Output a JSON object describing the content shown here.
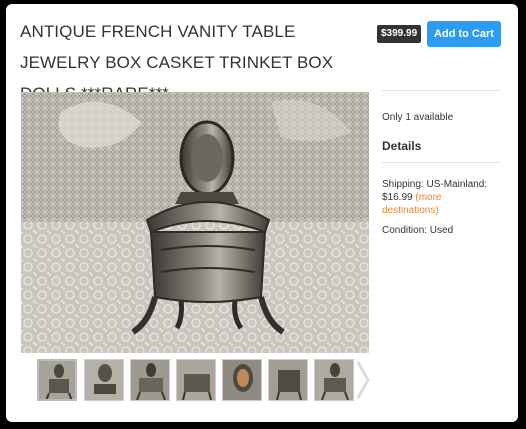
{
  "listing": {
    "title": "ANTIQUE FRENCH VANITY TABLE JEWELRY BOX CASKET TRINKET BOX DOLLS ***RARE***",
    "price": "$399.99",
    "add_to_cart": "Add to Cart"
  },
  "sidebar": {
    "availability": "Only 1 available",
    "details_heading": "Details",
    "shipping_prefix": "Shipping: US-Mainland:",
    "shipping_price": "$16.99",
    "more_destinations": "(more destinations)",
    "condition": "Condition: Used"
  },
  "gallery": {
    "thumbnail_count": 7,
    "selected_index": 0,
    "next_icon": "chevron-right-icon"
  },
  "colors": {
    "accent": "#2b9cf2",
    "link_orange": "#e8882e",
    "price_badge": "#333333"
  }
}
